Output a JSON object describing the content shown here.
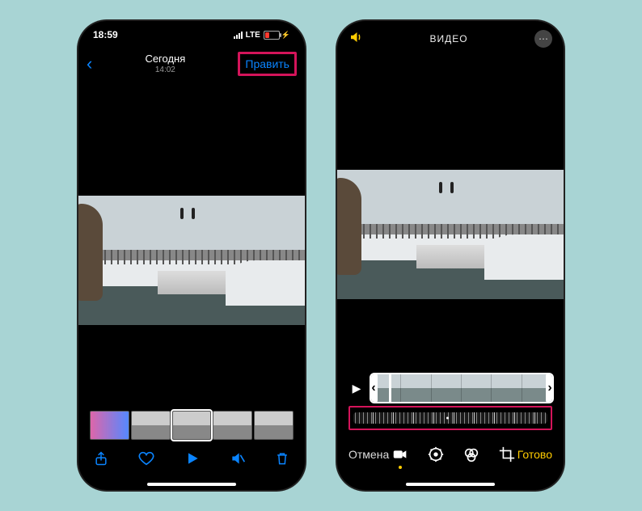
{
  "left": {
    "status": {
      "time": "18:59",
      "network": "LTE"
    },
    "title": "Сегодня",
    "subtitle": "14:02",
    "edit_label": "Править"
  },
  "right": {
    "title": "ВИДЕО",
    "cancel_label": "Отмена",
    "done_label": "Готово"
  },
  "icons": {
    "back": "back-chevron",
    "share": "share-icon",
    "heart": "favorite-icon",
    "play": "play-icon",
    "mute": "mute-icon",
    "trash": "trash-icon",
    "sound": "sound-icon",
    "more": "more-icon",
    "video_mode": "video-mode-icon",
    "adjust": "adjust-icon",
    "filters": "filters-icon",
    "crop": "crop-icon"
  }
}
